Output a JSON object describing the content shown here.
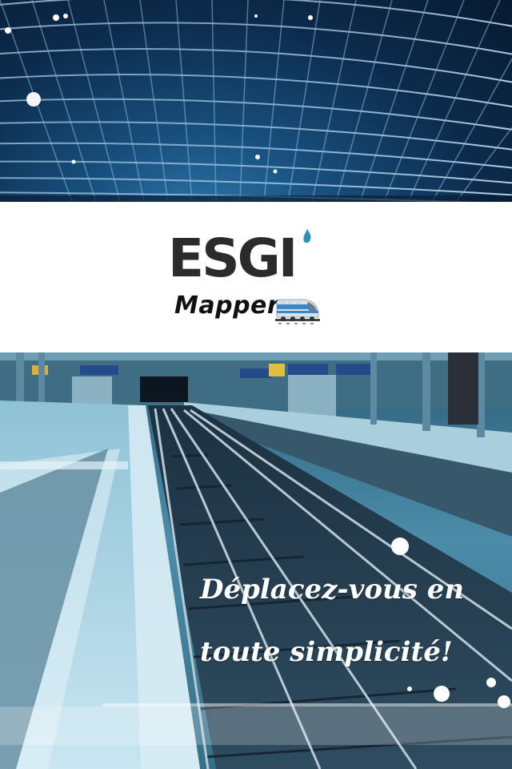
{
  "logo": {
    "brand": "ESGI",
    "product": "Mapper",
    "train_icon": "train-icon",
    "drop_color": "#2a8fbf"
  },
  "hero_top": {
    "image": "station-roof-photo"
  },
  "hero_bottom": {
    "image": "railway-platform-photo",
    "tagline_line1": "Déplacez-vous en",
    "tagline_line2": "toute simplicité!"
  },
  "colors": {
    "accent_blue": "#2a8fbf",
    "logo_text": "#2b2b2b"
  }
}
